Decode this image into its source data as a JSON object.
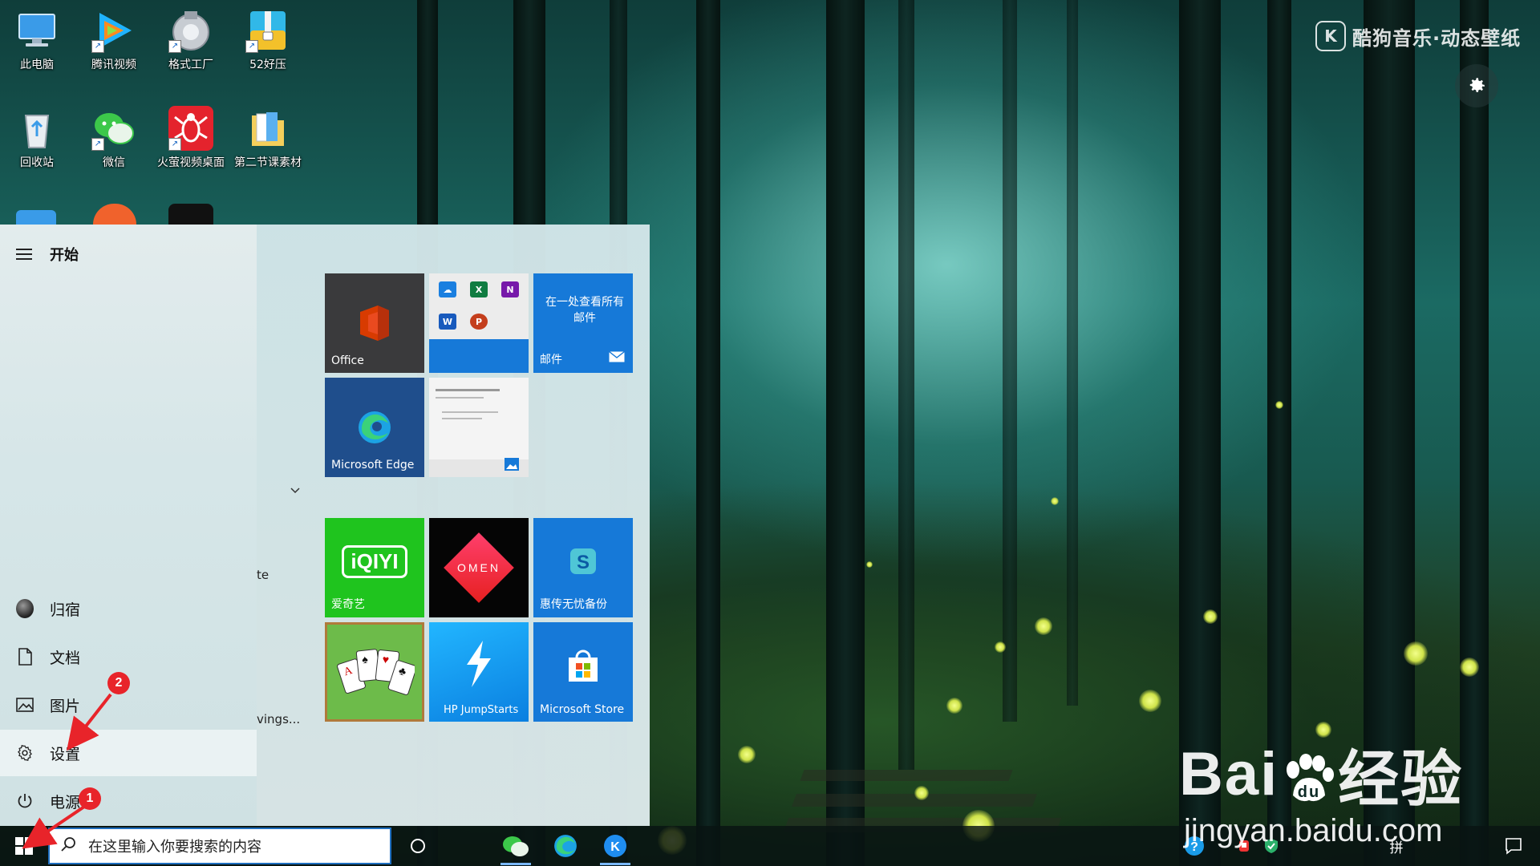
{
  "desktop": {
    "icons": [
      {
        "label": "此电脑",
        "icon": "computer-icon"
      },
      {
        "label": "腾讯视频",
        "icon": "tencent-video-icon"
      },
      {
        "label": "格式工厂",
        "icon": "format-factory-icon"
      },
      {
        "label": "52好压",
        "icon": "haozip-icon"
      },
      {
        "label": "回收站",
        "icon": "recycle-bin-icon"
      },
      {
        "label": "微信",
        "icon": "wechat-icon"
      },
      {
        "label": "火萤视频桌面",
        "icon": "firefly-video-icon"
      },
      {
        "label": "第二节课素材",
        "icon": "folder-icon"
      }
    ]
  },
  "kugou": {
    "logo_letter": "K",
    "brand": "酷狗音乐·动态壁纸"
  },
  "start_menu": {
    "title": "开始",
    "user": "归宿",
    "nav": {
      "documents": "文档",
      "pictures": "图片",
      "settings": "设置",
      "power": "电源"
    },
    "fragments": {
      "te": "te",
      "vings": "vings..."
    }
  },
  "tiles": {
    "office": "Office",
    "mail_desc": "在一处查看所有邮件",
    "mail": "邮件",
    "edge": "Microsoft Edge",
    "iqiyi": "爱奇艺",
    "iqiyi_logo": "iQIYI",
    "omen_logo": "OMEN",
    "backup": "惠传无忧备份",
    "jumpstarts": "HP JumpStarts",
    "store": "Microsoft Store"
  },
  "taskbar": {
    "search_placeholder": "在这里输入你要搜索的内容",
    "ime_label": "拼"
  },
  "annotations": {
    "badge1": "1",
    "badge2": "2"
  },
  "watermark": {
    "main_left": "Bai",
    "main_du": "du",
    "main_right": "经验",
    "url": "jingyan.baidu.com"
  }
}
